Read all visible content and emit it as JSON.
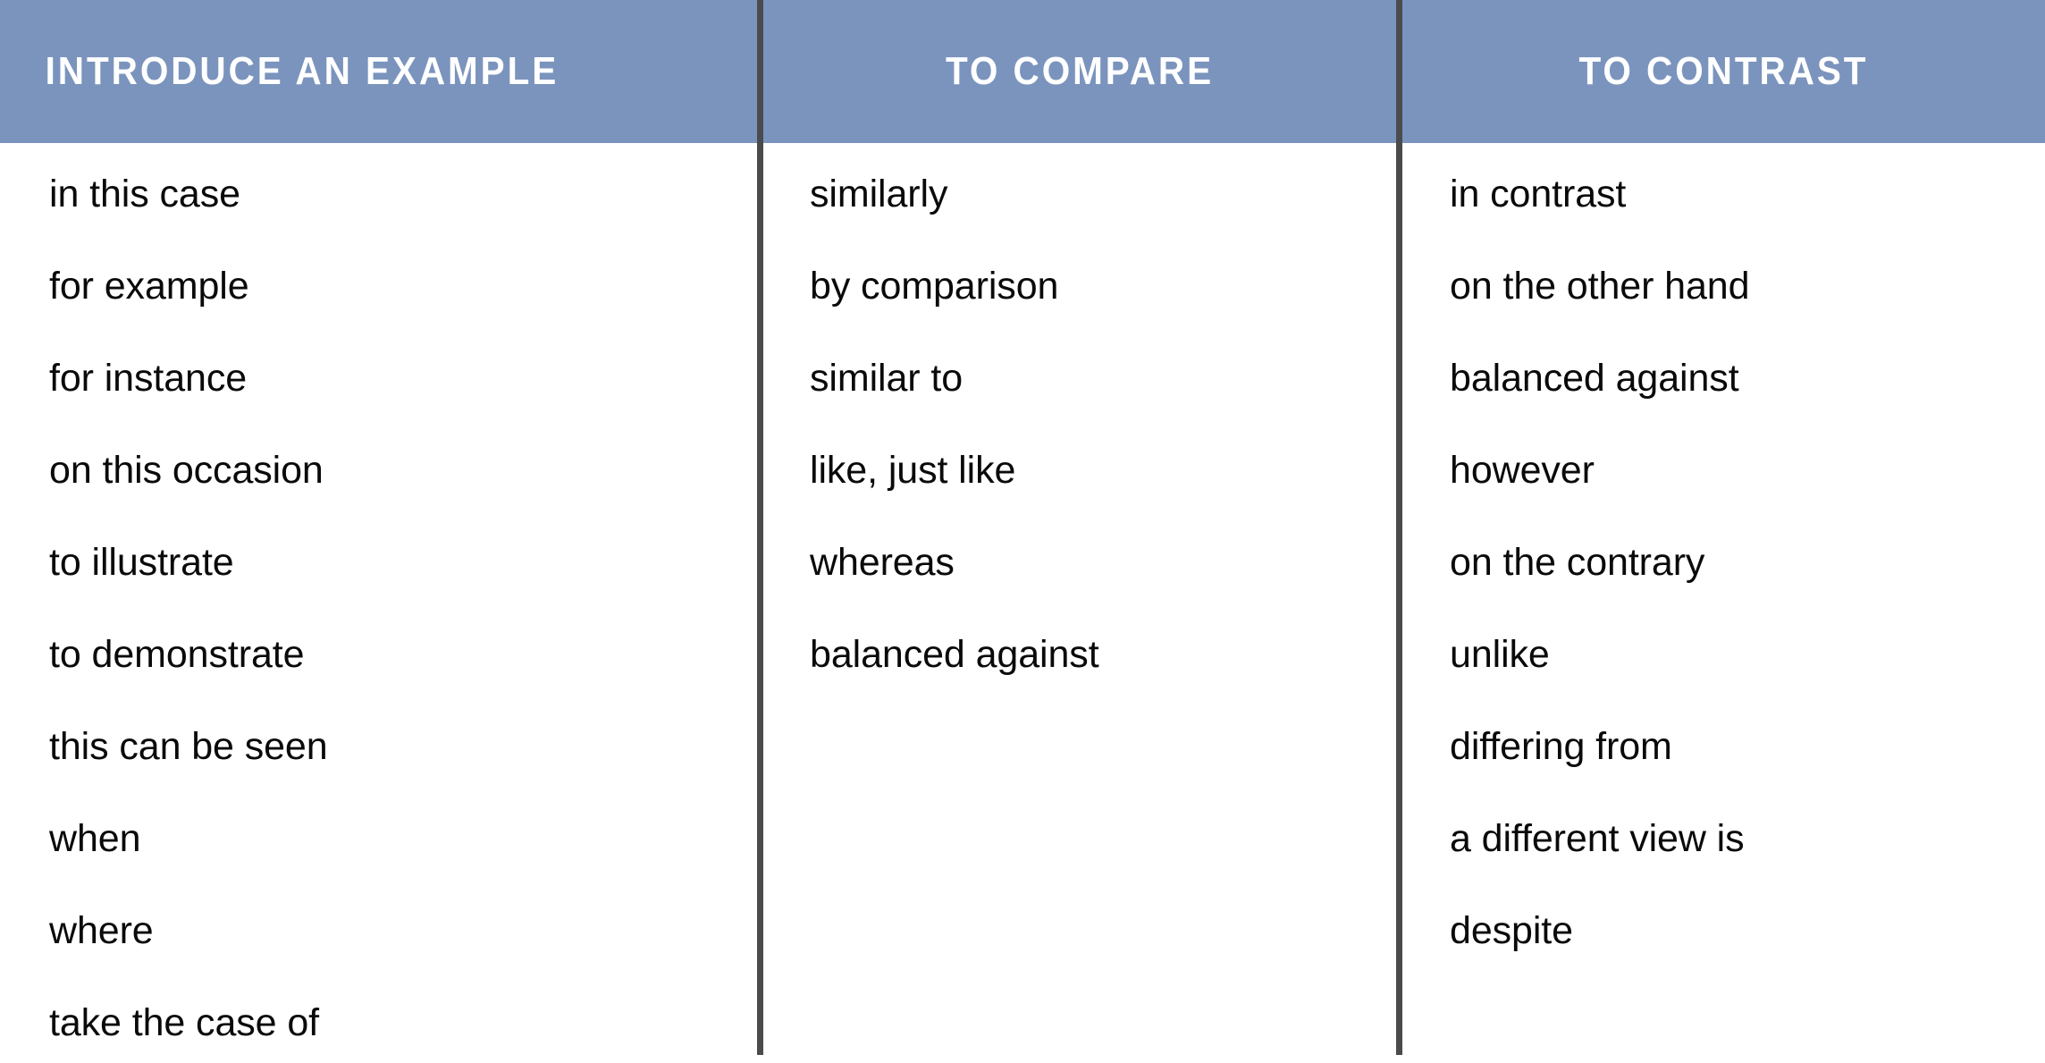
{
  "table": {
    "accent_color": "#7b94bd",
    "divider_color": "#4b4b4e",
    "header_text_color": "#ffffff",
    "body_text_color": "#0a0a0a",
    "background_color": "#ffffff",
    "columns": [
      {
        "header": "INTRODUCE AN EXAMPLE",
        "items": [
          "in this case",
          "for example",
          "for instance",
          "on this occasion",
          "to illustrate",
          "to demonstrate",
          "this can be seen",
          "when",
          "where",
          "take the case of"
        ]
      },
      {
        "header": "TO COMPARE",
        "items": [
          "similarly",
          "by comparison",
          "similar to",
          "like, just like",
          "whereas",
          "balanced against"
        ]
      },
      {
        "header": "TO CONTRAST",
        "items": [
          "in contrast",
          "on the other hand",
          "balanced against",
          "however",
          "on the contrary",
          "unlike",
          "differing from",
          "a different view is",
          "despite"
        ]
      }
    ]
  }
}
